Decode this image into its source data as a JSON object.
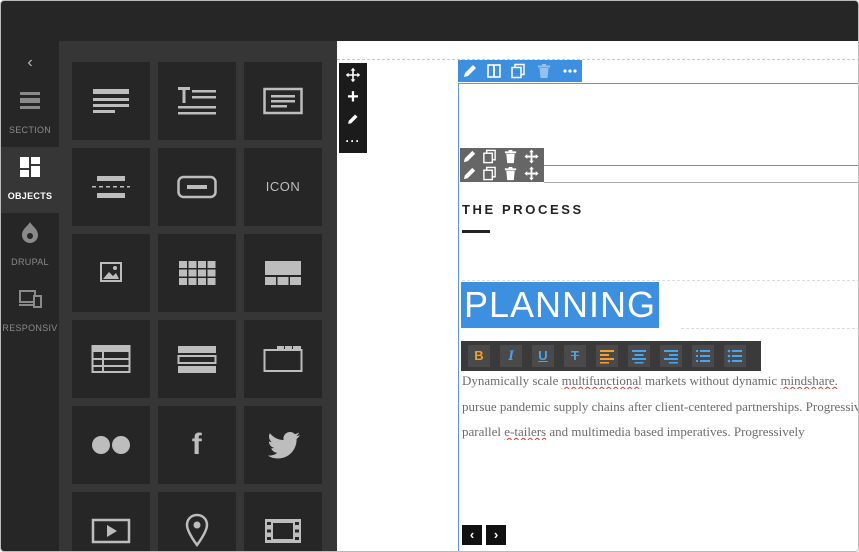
{
  "rail": {
    "back_glyph": "‹",
    "items": [
      {
        "label": "SECTION",
        "icon": "section-icon"
      },
      {
        "label": "OBJECTS",
        "icon": "objects-icon",
        "active": true
      },
      {
        "label": "DRUPAL",
        "icon": "drupal-icon"
      },
      {
        "label": "RESPONSIV",
        "icon": "responsive-icon"
      }
    ]
  },
  "objects": {
    "tiles": [
      {
        "icon": "text-block-icon"
      },
      {
        "icon": "title-text-icon"
      },
      {
        "icon": "text-box-icon"
      },
      {
        "icon": "divider-icon"
      },
      {
        "icon": "button-icon"
      },
      {
        "icon": "icon-element",
        "label": "ICON"
      },
      {
        "icon": "image-icon"
      },
      {
        "icon": "gallery-grid-icon"
      },
      {
        "icon": "slider-icon"
      },
      {
        "icon": "table-icon"
      },
      {
        "icon": "rows-icon"
      },
      {
        "icon": "tabs-icon"
      },
      {
        "icon": "flickr-icon"
      },
      {
        "icon": "facebook-icon",
        "glyph": "f"
      },
      {
        "icon": "twitter-icon"
      },
      {
        "icon": "video-icon"
      },
      {
        "icon": "map-pin-icon"
      },
      {
        "icon": "film-icon"
      }
    ]
  },
  "canvas": {
    "vertical_tools": [
      "move-icon",
      "add-icon",
      "edit-icon",
      "more-icon"
    ],
    "section_toolbar": [
      "edit-icon",
      "columns-icon",
      "copy-icon",
      "delete-icon",
      "more-icon"
    ],
    "element_toolbar": [
      "edit-icon",
      "copy-icon",
      "delete-icon",
      "move-icon"
    ],
    "heading": "THE PROCESS",
    "planning": "PLANNING",
    "format_buttons": [
      {
        "name": "bold",
        "glyph": "B"
      },
      {
        "name": "italic",
        "glyph": "I"
      },
      {
        "name": "underline",
        "glyph": "U"
      },
      {
        "name": "strikethrough",
        "glyph": "T"
      },
      {
        "name": "align-left",
        "glyph": ""
      },
      {
        "name": "align-center",
        "glyph": ""
      },
      {
        "name": "align-right",
        "glyph": ""
      },
      {
        "name": "ordered-list",
        "glyph": ""
      },
      {
        "name": "unordered-list",
        "glyph": ""
      }
    ],
    "paragraph": {
      "line1_a": "Dynamically scale ",
      "line1_b": "multifunctional",
      "line1_c": " markets without dynamic ",
      "line1_d": "mindshare.",
      "line2": "pursue pandemic supply chains after client-centered partnerships. Progressively",
      "line3_a": "parallel ",
      "line3_b": "e-tailers",
      "line3_c": " and multimedia based imperatives. Progressively"
    },
    "nav": {
      "prev": "‹",
      "next": "›"
    }
  },
  "colors": {
    "accent_blue": "#3d8fe0",
    "bold_orange": "#f0a030",
    "dark_panel": "#262626"
  }
}
